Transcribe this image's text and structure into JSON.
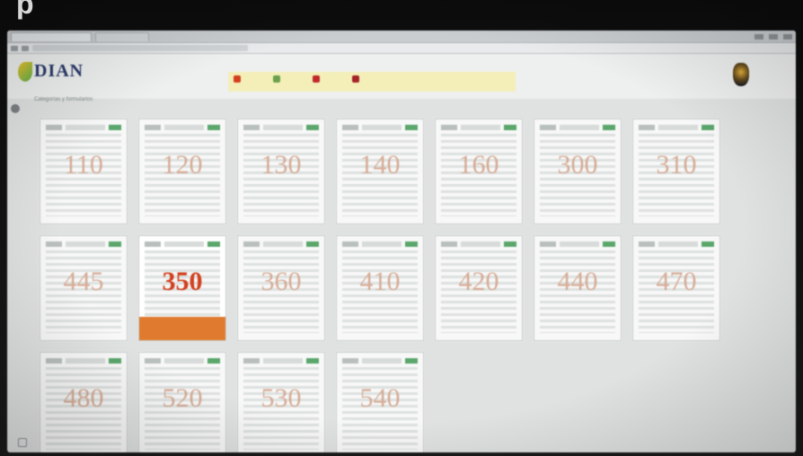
{
  "photo_text": "p",
  "app": {
    "logo": "DIAN",
    "breadcrumb": "Categorías y formularios",
    "actions": [
      {
        "icon": "person-icon",
        "color": "#d2401d"
      },
      {
        "icon": "document-icon",
        "color": "#6aa14a"
      },
      {
        "icon": "alert-icon",
        "color": "#c0282a"
      },
      {
        "icon": "circle-icon",
        "color": "#a52326"
      }
    ]
  },
  "forms": [
    {
      "number": "110"
    },
    {
      "number": "120"
    },
    {
      "number": "130"
    },
    {
      "number": "140"
    },
    {
      "number": "160"
    },
    {
      "number": "300"
    },
    {
      "number": "310"
    },
    {
      "number": "445"
    },
    {
      "number": "350",
      "active": true
    },
    {
      "number": "360"
    },
    {
      "number": "410"
    },
    {
      "number": "420"
    },
    {
      "number": "440"
    },
    {
      "number": "470"
    },
    {
      "number": "480"
    },
    {
      "number": "520"
    },
    {
      "number": "530"
    },
    {
      "number": "540"
    }
  ],
  "colors": {
    "accent": "#e07a2e",
    "number_faded": "#d4a28a",
    "number_active": "#d2401d"
  }
}
